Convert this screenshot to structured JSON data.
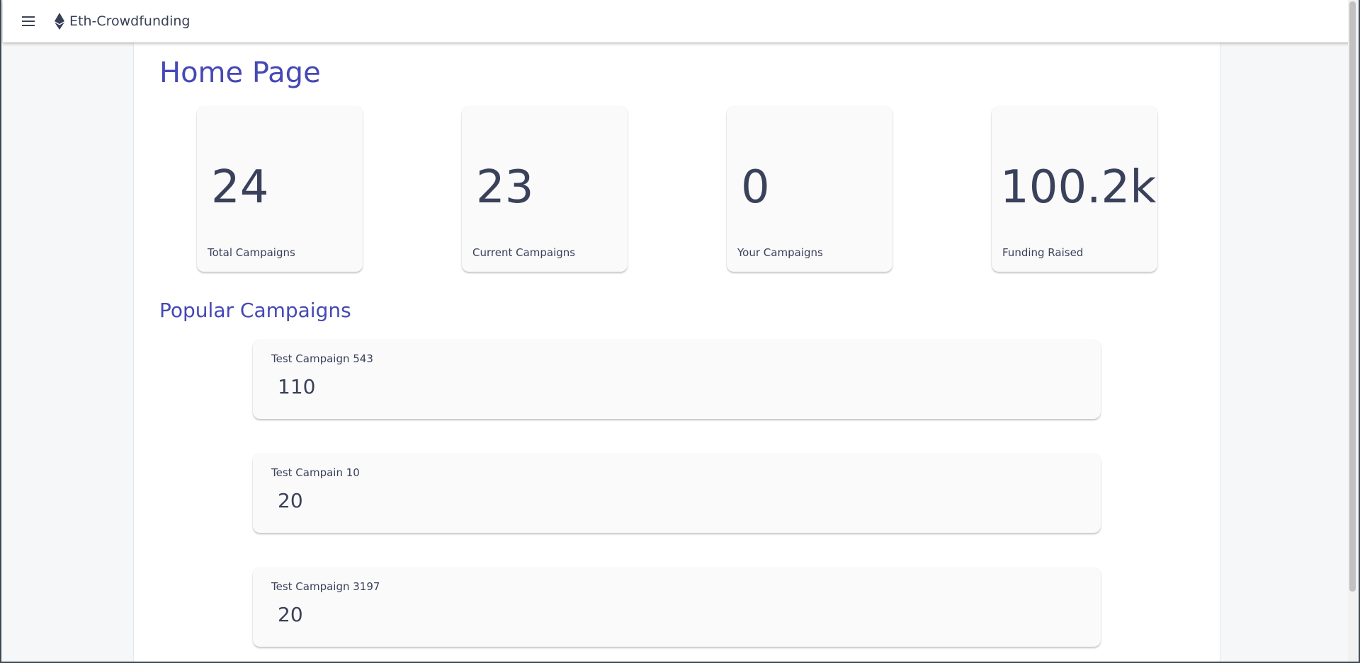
{
  "appbar": {
    "title": "Eth-Crowdfunding"
  },
  "page": {
    "title": "Home Page"
  },
  "stats": [
    {
      "value": "24",
      "label": "Total Campaigns"
    },
    {
      "value": "23",
      "label": "Current Campaigns"
    },
    {
      "value": "0",
      "label": "Your Campaigns"
    },
    {
      "value": "100.2k",
      "label": "Funding Raised"
    }
  ],
  "popular": {
    "title": "Popular Campaigns",
    "items": [
      {
        "name": "Test Campaign 543",
        "amount": "110"
      },
      {
        "name": "Test Campain 10",
        "amount": "20"
      },
      {
        "name": "Test Campaign 3197",
        "amount": "20"
      }
    ]
  },
  "colors": {
    "accent": "#4548b5",
    "text": "#3a415b",
    "card": "#fafafa"
  }
}
